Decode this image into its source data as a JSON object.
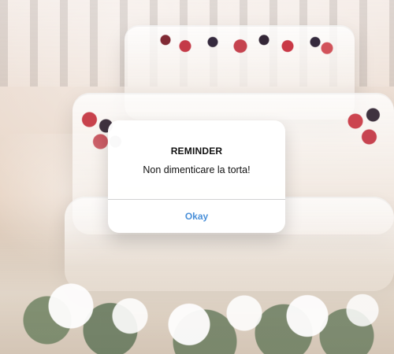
{
  "background": {
    "image_name": "wedding-cake-photo"
  },
  "alert": {
    "title": "REMINDER",
    "message": "Non dimenticare la torta!",
    "button_label": "Okay",
    "accent_color": "#4a90d9"
  }
}
